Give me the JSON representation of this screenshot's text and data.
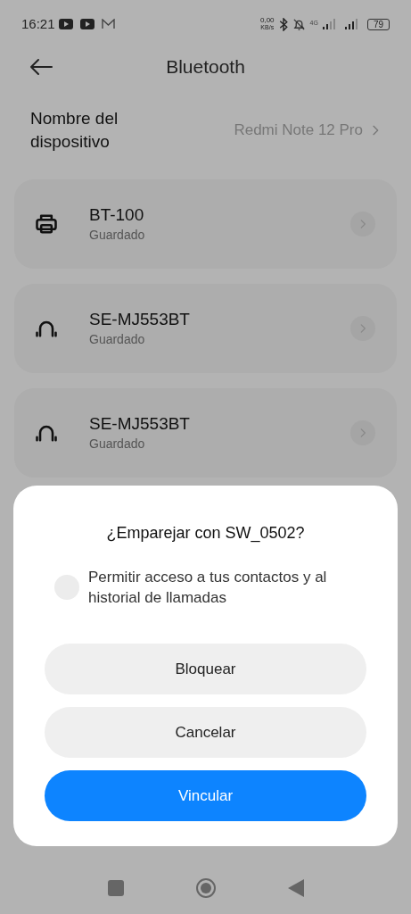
{
  "status_bar": {
    "time": "16:21",
    "speed_value": "0,00",
    "speed_unit": "KB/s",
    "network": "4G",
    "battery": "79"
  },
  "header": {
    "title": "Bluetooth"
  },
  "device_name": {
    "label": "Nombre del dispositivo",
    "value": "Redmi Note 12 Pro"
  },
  "devices": [
    {
      "kind": "printer",
      "name": "BT-100",
      "status": "Guardado"
    },
    {
      "kind": "headphones",
      "name": "SE-MJ553BT",
      "status": "Guardado"
    },
    {
      "kind": "headphones",
      "name": "SE-MJ553BT",
      "status": "Guardado"
    }
  ],
  "dialog": {
    "title": "¿Emparejar con SW_0502?",
    "option": {
      "label": "Permitir acceso a tus contactos y al historial de llamadas",
      "checked": false
    },
    "buttons": [
      {
        "kind": "secondary",
        "label": "Bloquear"
      },
      {
        "kind": "secondary",
        "label": "Cancelar"
      },
      {
        "kind": "primary",
        "label": "Vincular"
      }
    ]
  }
}
